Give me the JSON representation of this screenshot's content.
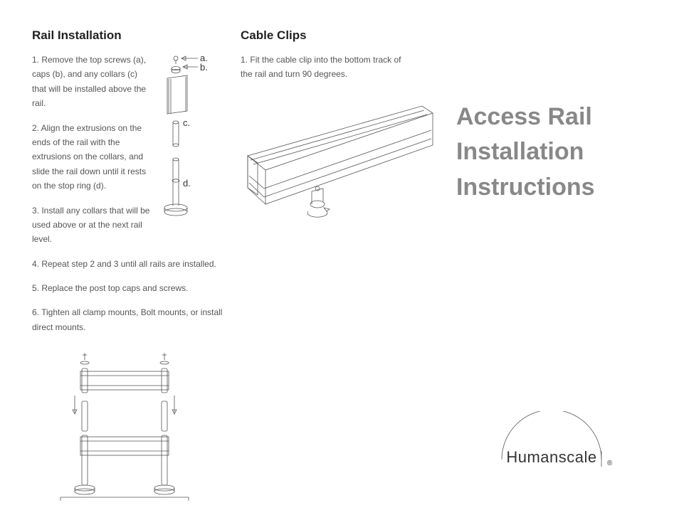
{
  "main_title_l1": "Access Rail",
  "main_title_l2": "Installation",
  "main_title_l3": "Instructions",
  "brand": "Humanscale",
  "reg_mark": "®",
  "rail": {
    "heading": "Rail Installation",
    "s1": "1. Remove the top screws (a), caps (b), and any collars (c) that will be installed above the rail.",
    "s2": "2. Align the extrusions on the ends of the rail with the extrusions on the collars, and slide the rail down until it rests on the stop ring (d).",
    "s3": "3. Install any collars that will be used above or at the next rail level.",
    "s4": "4. Repeat step 2 and 3 until all rails are installed.",
    "s5": "5. Replace the post top caps and screws.",
    "s6": "6. Tighten all clamp mounts, Bolt mounts, or install direct mounts.",
    "label_a": "a.",
    "label_b": "b.",
    "label_c": "c.",
    "label_d": "d."
  },
  "clips": {
    "heading": "Cable Clips",
    "s1": "1. Fit the cable clip into the bottom track of the rail and turn 90 degrees."
  }
}
